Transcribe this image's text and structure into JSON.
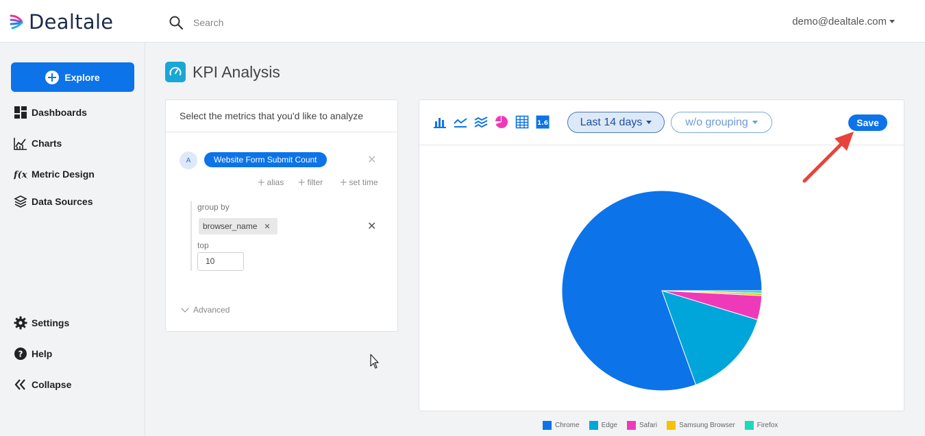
{
  "header": {
    "brand": "Dealtale",
    "search_placeholder": "Search",
    "user_email": "demo@dealtale.com"
  },
  "sidebar": {
    "explore_label": "Explore",
    "items": [
      {
        "label": "Dashboards",
        "icon": "dashboard-icon"
      },
      {
        "label": "Charts",
        "icon": "chart-icon"
      },
      {
        "label": "Metric Design",
        "icon": "function-icon"
      },
      {
        "label": "Data Sources",
        "icon": "layers-icon"
      }
    ],
    "bottom_items": [
      {
        "label": "Settings",
        "icon": "gear-icon"
      },
      {
        "label": "Help",
        "icon": "help-icon"
      },
      {
        "label": "Collapse",
        "icon": "collapse-icon"
      }
    ]
  },
  "page": {
    "title": "KPI Analysis"
  },
  "metrics_panel": {
    "header": "Select the metrics that you'd like to analyze",
    "metric_letter": "A",
    "metric_name": "Website Form Submit Count",
    "actions": [
      "alias",
      "filter",
      "set time"
    ],
    "group_by_label": "group by",
    "group_by_value": "browser_name",
    "top_label": "top",
    "top_value": "10",
    "advanced_label": "Advanced"
  },
  "chart_toolbar": {
    "chart_types": [
      "bar-chart-icon",
      "line-chart-icon",
      "area-chart-icon",
      "pie-chart-icon",
      "table-icon",
      "number-icon"
    ],
    "number_icon_text": "1.6",
    "date_range": "Last 14 days",
    "grouping": "w/o grouping",
    "save_label": "Save"
  },
  "colors": {
    "chrome": "#0d73e8",
    "edge": "#00a6d9",
    "safari": "#ee3ab8",
    "samsung": "#f7c200",
    "firefox": "#1fd8b8"
  },
  "chart_data": {
    "type": "pie",
    "categories": [
      "Chrome",
      "Edge",
      "Safari",
      "Samsung Browser",
      "Firefox"
    ],
    "values": [
      80.5,
      14.8,
      3.9,
      0.4,
      0.4
    ],
    "legend_position": "bottom"
  }
}
